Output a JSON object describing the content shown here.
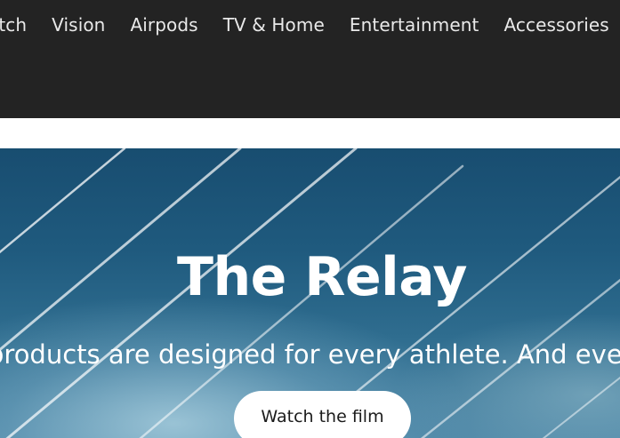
{
  "nav": {
    "items": [
      {
        "label": "atch"
      },
      {
        "label": "Vision"
      },
      {
        "label": "Airpods"
      },
      {
        "label": "TV & Home"
      },
      {
        "label": "Entertainment"
      },
      {
        "label": "Accessories"
      }
    ]
  },
  "hero": {
    "title": "The Relay",
    "subtitle": "products are designed for every athlete. And eve",
    "cta_label": "Watch the film"
  },
  "colors": {
    "nav_background": "#232323",
    "nav_text": "#e9e9e9",
    "hero_dark": "#184d70",
    "hero_light": "#a8cede",
    "button_background": "#ffffff"
  }
}
